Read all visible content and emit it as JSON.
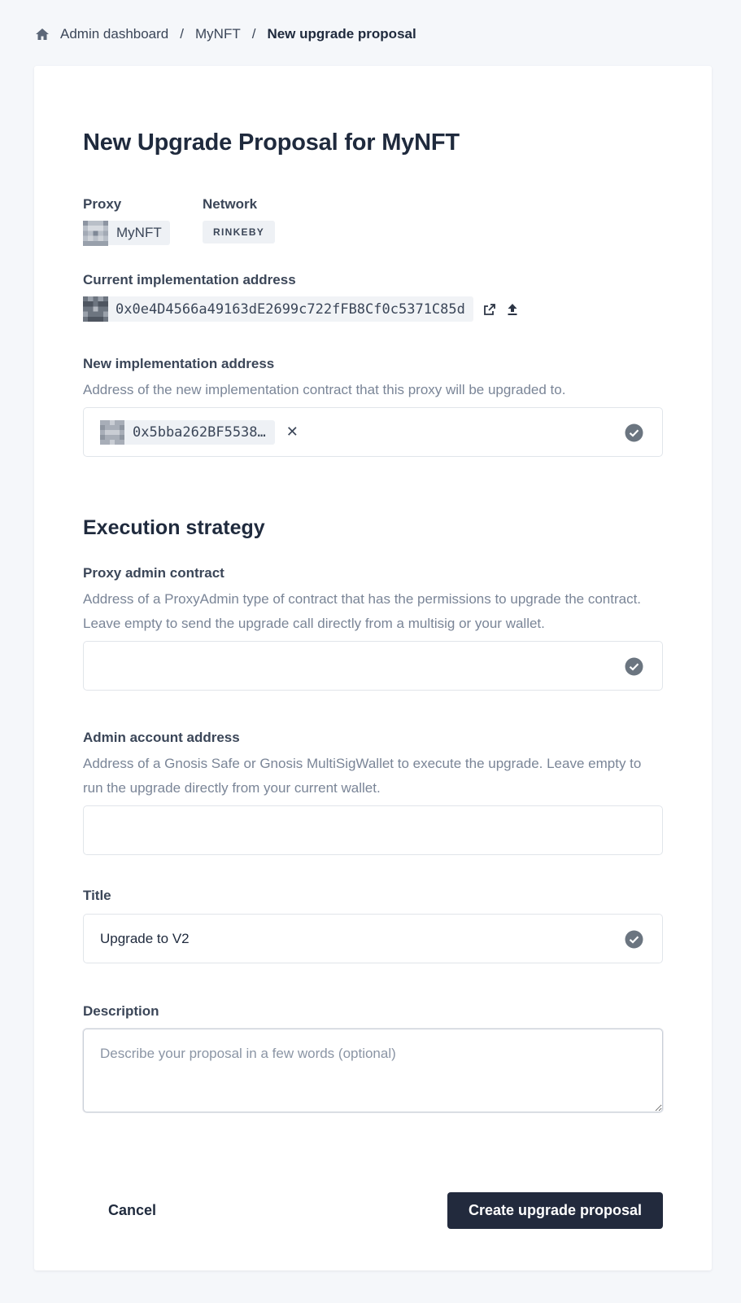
{
  "breadcrumb": {
    "items": [
      "Admin dashboard",
      "MyNFT"
    ],
    "current": "New upgrade proposal",
    "separator": "/"
  },
  "page": {
    "title": "New Upgrade Proposal for MyNFT"
  },
  "proxy": {
    "label": "Proxy",
    "value": "MyNFT"
  },
  "network": {
    "label": "Network",
    "value": "RINKEBY"
  },
  "current_implementation": {
    "label": "Current implementation address",
    "address": "0x0e4D4566a49163dE2699c722fFB8Cf0c5371C85d"
  },
  "new_implementation": {
    "label": "New implementation address",
    "help": "Address of the new implementation contract that this proxy will be upgraded to.",
    "address": "0x5bba262BF5538…",
    "clear_symbol": "✕"
  },
  "execution": {
    "title": "Execution strategy"
  },
  "proxy_admin": {
    "label": "Proxy admin contract",
    "help": "Address of a ProxyAdmin type of contract that has the permissions to upgrade the contract. Leave empty to send the upgrade call directly from a multisig or your wallet.",
    "value": ""
  },
  "admin_account": {
    "label": "Admin account address",
    "help": "Address of a Gnosis Safe or Gnosis MultiSigWallet to execute the upgrade. Leave empty to run the upgrade directly from your current wallet.",
    "value": ""
  },
  "title_field": {
    "label": "Title",
    "value": "Upgrade to V2"
  },
  "description": {
    "label": "Description",
    "placeholder": "Describe your proposal in a few words (optional)"
  },
  "actions": {
    "cancel": "Cancel",
    "submit": "Create upgrade proposal"
  },
  "colors": {
    "primary_button": "#222a3d",
    "check": "#6b7580",
    "background": "#f5f7fa"
  }
}
